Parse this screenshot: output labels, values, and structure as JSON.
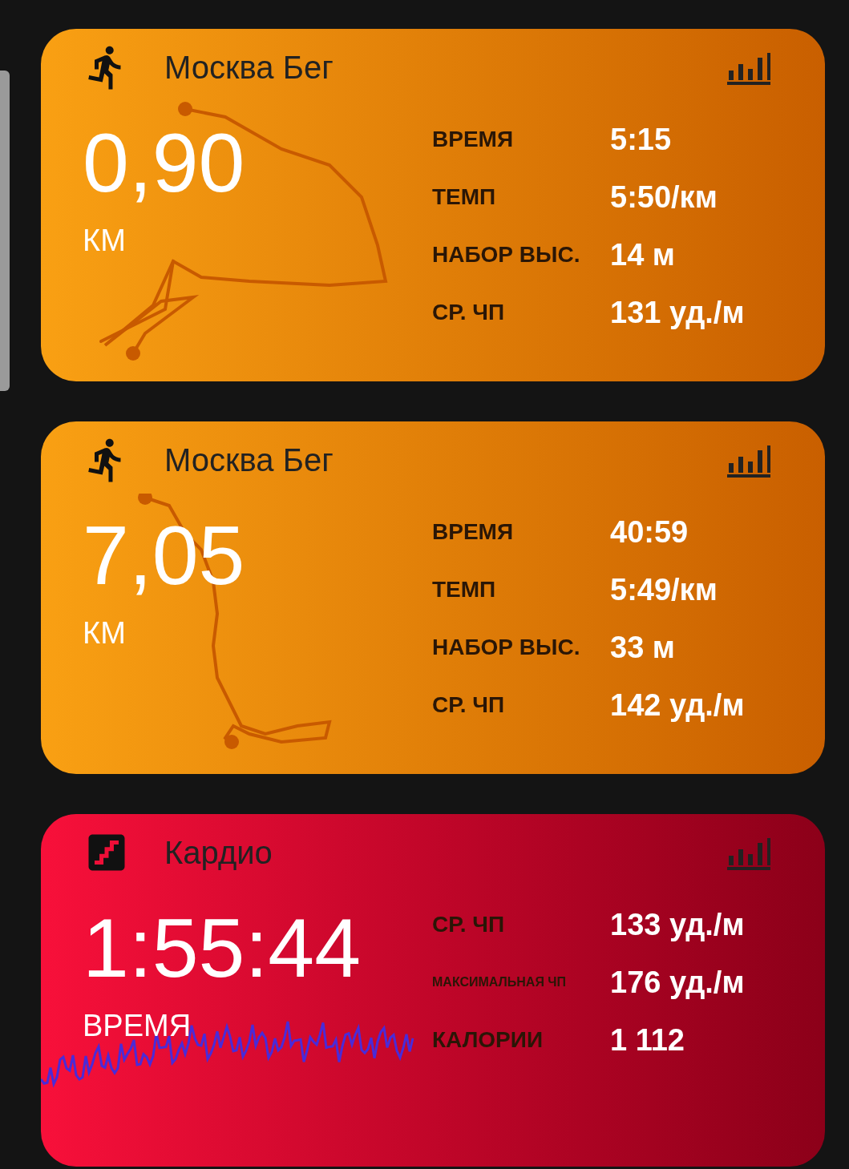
{
  "cards": [
    {
      "kind": "run",
      "title": "Москва Бег",
      "big_value": "0,90",
      "big_label": "КМ",
      "stats": [
        {
          "label": "ВРЕМЯ",
          "value": "5:15",
          "kind": "normal"
        },
        {
          "label": "ТЕМП",
          "value": "5:50/км",
          "kind": "normal"
        },
        {
          "label": "НАБОР ВЫС.",
          "value": "14 м",
          "kind": "normal"
        },
        {
          "label": "СР. ЧП",
          "value": "131 уд./м",
          "kind": "normal"
        }
      ]
    },
    {
      "kind": "run",
      "title": "Москва Бег",
      "big_value": "7,05",
      "big_label": "КМ",
      "stats": [
        {
          "label": "ВРЕМЯ",
          "value": "40:59",
          "kind": "normal"
        },
        {
          "label": "ТЕМП",
          "value": "5:49/км",
          "kind": "normal"
        },
        {
          "label": "НАБОР ВЫС.",
          "value": "33 м",
          "kind": "normal"
        },
        {
          "label": "СР. ЧП",
          "value": "142 уд./м",
          "kind": "normal"
        }
      ]
    },
    {
      "kind": "cardio",
      "title": "Кардио",
      "big_value": "1:55:44",
      "big_label": "ВРЕМЯ",
      "stats": [
        {
          "label": "СР. ЧП",
          "value": "133 уд./м",
          "kind": "normal"
        },
        {
          "label": "МАКСИМАЛЬНАЯ ЧП",
          "value": "176 уд./м",
          "kind": "small"
        },
        {
          "label": "КАЛОРИИ",
          "value": "1 112",
          "kind": "normal"
        }
      ]
    }
  ]
}
